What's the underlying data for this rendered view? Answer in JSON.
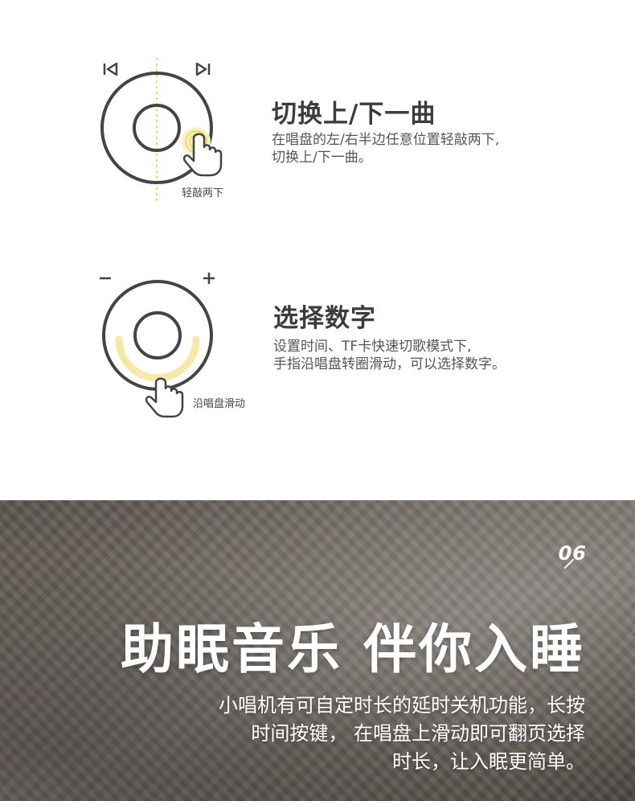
{
  "feature1": {
    "title": "切换上/下一曲",
    "desc_line1": "在唱盘的左/右半边任意位置轻敲两下,",
    "desc_line2": "切换上/下一曲。",
    "caption": "轻敲两下",
    "icons": [
      "prev-track-icon",
      "next-track-icon",
      "tap-hand-icon"
    ]
  },
  "feature2": {
    "title": "选择数字",
    "desc_line1": "设置时间、TF卡快速切歌模式下,",
    "desc_line2": "手指沿唱盘转圈滑动，可以选择数字。",
    "caption": "沿唱盘滑动",
    "minus_label": "−",
    "plus_label": "+",
    "icons": [
      "minus-icon",
      "plus-icon",
      "swipe-hand-icon"
    ]
  },
  "banner": {
    "number": "06",
    "headline": "助眠音乐 伴你入睡",
    "body_line1": "小唱机有可自定时长的延时关机功能，长按",
    "body_line2": "时间按键， 在唱盘上滑动即可翻页选择",
    "body_line3": "时长，让入眠更简单。"
  },
  "colors": {
    "accent_yellow": "#f6e9a6",
    "dotted_line": "#f2d86a",
    "stroke": "#444444"
  }
}
